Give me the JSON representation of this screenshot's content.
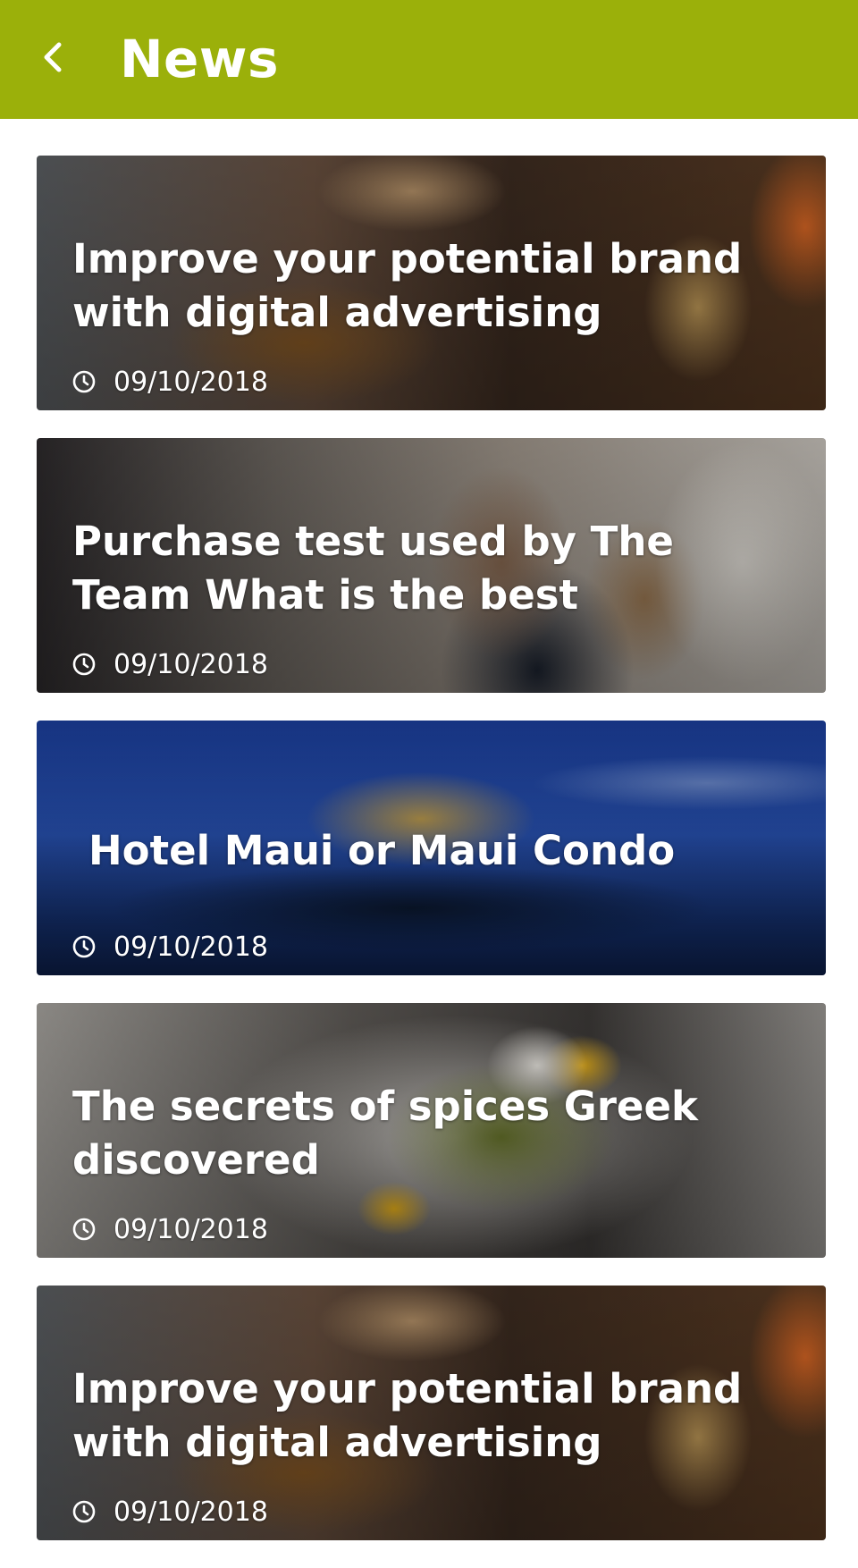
{
  "header": {
    "title": "News",
    "background_color": "#9bb00a",
    "back_icon": "chevron-left-icon"
  },
  "articles": [
    {
      "title": "Improve your potential brand with digital advertising",
      "date": "09/10/2018",
      "image_theme": "food-market"
    },
    {
      "title": "Purchase test used by The Team What is the best",
      "date": "09/10/2018",
      "image_theme": "cafe"
    },
    {
      "title": "Hotel Maui or Maui Condo",
      "date": "09/10/2018",
      "image_theme": "castle"
    },
    {
      "title": "The secrets of spices Greek discovered",
      "date": "09/10/2018",
      "image_theme": "eggs"
    },
    {
      "title": "Improve your potential brand with digital advertising",
      "date": "09/10/2018",
      "image_theme": "food-market"
    }
  ]
}
